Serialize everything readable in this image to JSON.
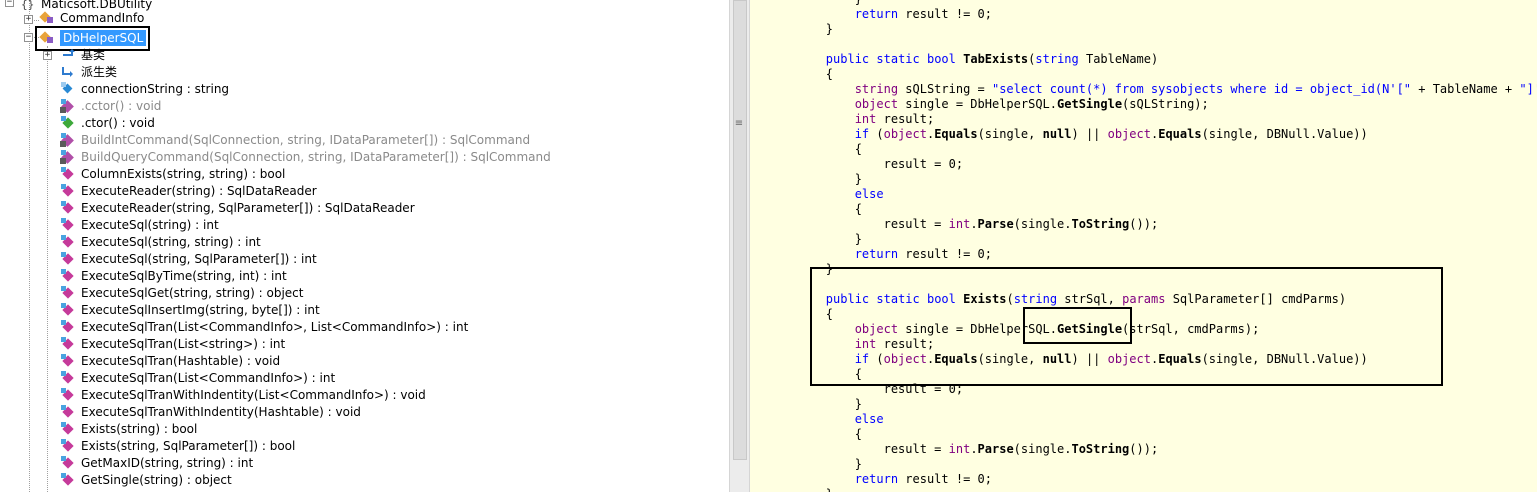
{
  "tree": {
    "namespace": "Maticsoft.DBUtility",
    "class_command_info": "CommandInfo",
    "class_selected": "DbHelperSQL",
    "base_types": "基类",
    "derived_types": "派生类",
    "members": [
      {
        "label": "connectionString : string",
        "gray": false,
        "icon": "field-icon"
      },
      {
        "label": ".cctor() : void",
        "gray": true,
        "icon": "private-static-method-icon"
      },
      {
        "label": ".ctor() : void",
        "gray": false,
        "icon": "constructor-icon"
      },
      {
        "label": "BuildIntCommand(SqlConnection, string, IDataParameter[]) : SqlCommand",
        "gray": true,
        "icon": "private-static-method-icon"
      },
      {
        "label": "BuildQueryCommand(SqlConnection, string, IDataParameter[]) : SqlCommand",
        "gray": true,
        "icon": "private-static-method-icon"
      },
      {
        "label": "ColumnExists(string, string) : bool",
        "gray": false,
        "icon": "public-static-method-icon"
      },
      {
        "label": "ExecuteReader(string) : SqlDataReader",
        "gray": false,
        "icon": "public-static-method-icon"
      },
      {
        "label": "ExecuteReader(string, SqlParameter[]) : SqlDataReader",
        "gray": false,
        "icon": "public-static-method-icon"
      },
      {
        "label": "ExecuteSql(string) : int",
        "gray": false,
        "icon": "public-static-method-icon"
      },
      {
        "label": "ExecuteSql(string, string) : int",
        "gray": false,
        "icon": "public-static-method-icon"
      },
      {
        "label": "ExecuteSql(string, SqlParameter[]) : int",
        "gray": false,
        "icon": "public-static-method-icon"
      },
      {
        "label": "ExecuteSqlByTime(string, int) : int",
        "gray": false,
        "icon": "public-static-method-icon"
      },
      {
        "label": "ExecuteSqlGet(string, string) : object",
        "gray": false,
        "icon": "public-static-method-icon"
      },
      {
        "label": "ExecuteSqlInsertImg(string, byte[]) : int",
        "gray": false,
        "icon": "public-static-method-icon"
      },
      {
        "label": "ExecuteSqlTran(List<CommandInfo>, List<CommandInfo>) : int",
        "gray": false,
        "icon": "public-static-method-icon"
      },
      {
        "label": "ExecuteSqlTran(List<string>) : int",
        "gray": false,
        "icon": "public-static-method-icon"
      },
      {
        "label": "ExecuteSqlTran(Hashtable) : void",
        "gray": false,
        "icon": "public-static-method-icon"
      },
      {
        "label": "ExecuteSqlTran(List<CommandInfo>) : int",
        "gray": false,
        "icon": "public-static-method-icon"
      },
      {
        "label": "ExecuteSqlTranWithIndentity(List<CommandInfo>) : void",
        "gray": false,
        "icon": "public-static-method-icon"
      },
      {
        "label": "ExecuteSqlTranWithIndentity(Hashtable) : void",
        "gray": false,
        "icon": "public-static-method-icon"
      },
      {
        "label": "Exists(string) : bool",
        "gray": false,
        "icon": "public-static-method-icon"
      },
      {
        "label": "Exists(string, SqlParameter[]) : bool",
        "gray": false,
        "icon": "public-static-method-icon"
      },
      {
        "label": "GetMaxID(string, string) : int",
        "gray": false,
        "icon": "public-static-method-icon"
      },
      {
        "label": "GetSingle(string) : object",
        "gray": false,
        "icon": "public-static-method-icon"
      }
    ]
  },
  "splitter_grip": "≡",
  "code": [
    {
      "tokens": [
        {
          "t": "            }",
          "c": ""
        }
      ]
    },
    {
      "tokens": [
        {
          "t": "            ",
          "c": ""
        },
        {
          "t": "return",
          "c": "kw"
        },
        {
          "t": " result != 0;",
          "c": ""
        }
      ]
    },
    {
      "tokens": [
        {
          "t": "        }",
          "c": ""
        }
      ]
    },
    {
      "tokens": [
        {
          "t": "",
          "c": ""
        }
      ]
    },
    {
      "tokens": [
        {
          "t": "        ",
          "c": ""
        },
        {
          "t": "public",
          "c": "kw"
        },
        {
          "t": " ",
          "c": ""
        },
        {
          "t": "static",
          "c": "kw"
        },
        {
          "t": " ",
          "c": ""
        },
        {
          "t": "bool",
          "c": "kw"
        },
        {
          "t": " ",
          "c": ""
        },
        {
          "t": "TabExists",
          "c": "bold"
        },
        {
          "t": "(",
          "c": ""
        },
        {
          "t": "string",
          "c": "kw"
        },
        {
          "t": " TableName)",
          "c": ""
        }
      ]
    },
    {
      "tokens": [
        {
          "t": "        {",
          "c": ""
        }
      ]
    },
    {
      "tokens": [
        {
          "t": "            ",
          "c": ""
        },
        {
          "t": "string",
          "c": "kw2"
        },
        {
          "t": " sQLString = ",
          "c": ""
        },
        {
          "t": "\"select count(*) from sysobjects where id = object_id(N'[\"",
          "c": "str"
        },
        {
          "t": " + TableName + ",
          "c": ""
        },
        {
          "t": "\"]') a",
          "c": "str"
        }
      ]
    },
    {
      "tokens": [
        {
          "t": "            ",
          "c": ""
        },
        {
          "t": "object",
          "c": "kw2"
        },
        {
          "t": " single = DbHelperSQL.",
          "c": ""
        },
        {
          "t": "GetSingle",
          "c": "bold"
        },
        {
          "t": "(sQLString);",
          "c": ""
        }
      ]
    },
    {
      "tokens": [
        {
          "t": "            ",
          "c": ""
        },
        {
          "t": "int",
          "c": "kw2"
        },
        {
          "t": " result;",
          "c": ""
        }
      ]
    },
    {
      "tokens": [
        {
          "t": "            ",
          "c": ""
        },
        {
          "t": "if",
          "c": "kw"
        },
        {
          "t": " (",
          "c": ""
        },
        {
          "t": "object",
          "c": "kw2"
        },
        {
          "t": ".",
          "c": ""
        },
        {
          "t": "Equals",
          "c": "bold"
        },
        {
          "t": "(single, ",
          "c": ""
        },
        {
          "t": "null",
          "c": "bold"
        },
        {
          "t": ") || ",
          "c": ""
        },
        {
          "t": "object",
          "c": "kw2"
        },
        {
          "t": ".",
          "c": ""
        },
        {
          "t": "Equals",
          "c": "bold"
        },
        {
          "t": "(single, DBNull.Value))",
          "c": ""
        }
      ]
    },
    {
      "tokens": [
        {
          "t": "            {",
          "c": ""
        }
      ]
    },
    {
      "tokens": [
        {
          "t": "                result = 0;",
          "c": ""
        }
      ]
    },
    {
      "tokens": [
        {
          "t": "            }",
          "c": ""
        }
      ]
    },
    {
      "tokens": [
        {
          "t": "            ",
          "c": ""
        },
        {
          "t": "else",
          "c": "kw"
        }
      ]
    },
    {
      "tokens": [
        {
          "t": "            {",
          "c": ""
        }
      ]
    },
    {
      "tokens": [
        {
          "t": "                result = ",
          "c": ""
        },
        {
          "t": "int",
          "c": "kw2"
        },
        {
          "t": ".",
          "c": ""
        },
        {
          "t": "Parse",
          "c": "bold"
        },
        {
          "t": "(single.",
          "c": ""
        },
        {
          "t": "ToString",
          "c": "bold"
        },
        {
          "t": "());",
          "c": ""
        }
      ]
    },
    {
      "tokens": [
        {
          "t": "            }",
          "c": ""
        }
      ]
    },
    {
      "tokens": [
        {
          "t": "            ",
          "c": ""
        },
        {
          "t": "return",
          "c": "kw"
        },
        {
          "t": " result != 0;",
          "c": ""
        }
      ]
    },
    {
      "tokens": [
        {
          "t": "        }",
          "c": ""
        }
      ]
    },
    {
      "tokens": [
        {
          "t": "",
          "c": ""
        }
      ]
    },
    {
      "tokens": [
        {
          "t": "        ",
          "c": ""
        },
        {
          "t": "public",
          "c": "kw"
        },
        {
          "t": " ",
          "c": ""
        },
        {
          "t": "static",
          "c": "kw"
        },
        {
          "t": " ",
          "c": ""
        },
        {
          "t": "bool",
          "c": "kw"
        },
        {
          "t": " ",
          "c": ""
        },
        {
          "t": "Exists",
          "c": "bold"
        },
        {
          "t": "(",
          "c": ""
        },
        {
          "t": "string",
          "c": "kw"
        },
        {
          "t": " strSql, ",
          "c": ""
        },
        {
          "t": "params",
          "c": "kw2"
        },
        {
          "t": " SqlParameter[] cmdParms)",
          "c": ""
        }
      ]
    },
    {
      "tokens": [
        {
          "t": "        {",
          "c": ""
        }
      ]
    },
    {
      "tokens": [
        {
          "t": "            ",
          "c": ""
        },
        {
          "t": "object",
          "c": "kw2"
        },
        {
          "t": " single = DbHelperSQL.",
          "c": ""
        },
        {
          "t": "GetSingle",
          "c": "bold"
        },
        {
          "t": "(strSql, cmdParms);",
          "c": ""
        }
      ]
    },
    {
      "tokens": [
        {
          "t": "            ",
          "c": ""
        },
        {
          "t": "int",
          "c": "kw2"
        },
        {
          "t": " result;",
          "c": ""
        }
      ]
    },
    {
      "tokens": [
        {
          "t": "            ",
          "c": ""
        },
        {
          "t": "if",
          "c": "kw"
        },
        {
          "t": " (",
          "c": ""
        },
        {
          "t": "object",
          "c": "kw2"
        },
        {
          "t": ".",
          "c": ""
        },
        {
          "t": "Equals",
          "c": "bold"
        },
        {
          "t": "(single, ",
          "c": ""
        },
        {
          "t": "null",
          "c": "bold"
        },
        {
          "t": ") || ",
          "c": ""
        },
        {
          "t": "object",
          "c": "kw2"
        },
        {
          "t": ".",
          "c": ""
        },
        {
          "t": "Equals",
          "c": "bold"
        },
        {
          "t": "(single, DBNull.Value))",
          "c": ""
        }
      ]
    },
    {
      "tokens": [
        {
          "t": "            {",
          "c": ""
        }
      ]
    },
    {
      "tokens": [
        {
          "t": "                result = 0;",
          "c": ""
        }
      ]
    },
    {
      "tokens": [
        {
          "t": "            }",
          "c": ""
        }
      ]
    },
    {
      "tokens": [
        {
          "t": "            ",
          "c": ""
        },
        {
          "t": "else",
          "c": "kw"
        }
      ]
    },
    {
      "tokens": [
        {
          "t": "            {",
          "c": ""
        }
      ]
    },
    {
      "tokens": [
        {
          "t": "                result = ",
          "c": ""
        },
        {
          "t": "int",
          "c": "kw2"
        },
        {
          "t": ".",
          "c": ""
        },
        {
          "t": "Parse",
          "c": "bold"
        },
        {
          "t": "(single.",
          "c": ""
        },
        {
          "t": "ToString",
          "c": "bold"
        },
        {
          "t": "());",
          "c": ""
        }
      ]
    },
    {
      "tokens": [
        {
          "t": "            }",
          "c": ""
        }
      ]
    },
    {
      "tokens": [
        {
          "t": "            ",
          "c": ""
        },
        {
          "t": "return",
          "c": "kw"
        },
        {
          "t": " result != 0;",
          "c": ""
        }
      ]
    },
    {
      "tokens": [
        {
          "t": "        }",
          "c": ""
        }
      ]
    }
  ]
}
